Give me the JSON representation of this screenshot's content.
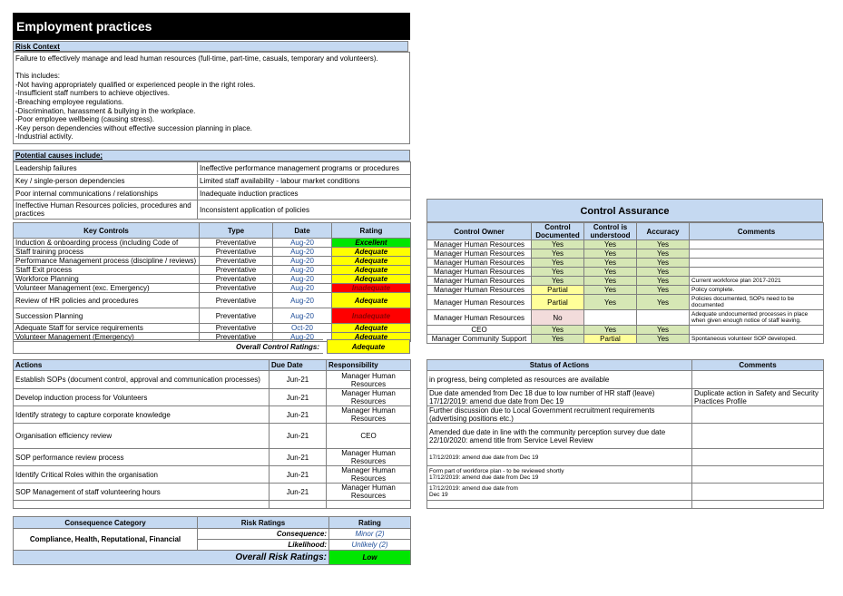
{
  "title": "Employment practices",
  "risk_context": {
    "heading": "Risk Context",
    "lines": [
      "Failure to effectively manage and lead human resources (full-time, part-time, casuals, temporary and volunteers).",
      "",
      "This includes:",
      "-Not having appropriately qualified or experienced people in the right roles.",
      "-Insufficient staff numbers to achieve objectives.",
      "-Breaching employee regulations.",
      "-Discrimination, harassment & bullying in the workplace.",
      "-Poor employee wellbeing (causing stress).",
      "-Key person dependencies without effective succession planning in place.",
      "-Industrial activity."
    ]
  },
  "causes": {
    "heading": "Potential causes include;",
    "rows": [
      [
        "Leadership failures",
        "Ineffective performance management programs or procedures"
      ],
      [
        "Key / single-person dependencies",
        "Limited staff availability - labour market conditions"
      ],
      [
        "Poor internal communications / relationships",
        "Inadequate induction practices"
      ],
      [
        "Ineffective Human Resources policies, procedures and practices",
        "Inconsistent application of policies"
      ]
    ]
  },
  "controls": {
    "headers": [
      "Key Controls",
      "Type",
      "Date",
      "Rating"
    ],
    "rows": [
      {
        "control": "Induction & onboarding process (including Code of",
        "type": "Preventative",
        "date": "Aug-20",
        "rating": "Excellent",
        "rc": "grn"
      },
      {
        "control": "Staff training process",
        "type": "Preventative",
        "date": "Aug-20",
        "rating": "Adequate",
        "rc": "yel"
      },
      {
        "control": "Performance Management process (discipline / reviews)",
        "type": "Preventative",
        "date": "Aug-20",
        "rating": "Adequate",
        "rc": "yel"
      },
      {
        "control": "Staff Exit process",
        "type": "Preventative",
        "date": "Aug-20",
        "rating": "Adequate",
        "rc": "yel"
      },
      {
        "control": "Workforce Planning",
        "type": "Preventative",
        "date": "Aug-20",
        "rating": "Adequate",
        "rc": "yel"
      },
      {
        "control": "Volunteer Management (exc. Emergency)",
        "type": "Preventative",
        "date": "Aug-20",
        "rating": "Inadequate",
        "rc": "red"
      },
      {
        "control": "Review of HR policies and procedures",
        "type": "Preventative",
        "date": "Aug-20",
        "rating": "Adequate",
        "rc": "yel"
      },
      {
        "control": "Succession Planning",
        "type": "Preventative",
        "date": "Aug-20",
        "rating": "Inadequate",
        "rc": "red"
      },
      {
        "control": "Adequate Staff for service requirements",
        "type": "Preventative",
        "date": "Oct-20",
        "rating": "Adequate",
        "rc": "yel"
      },
      {
        "control": "Volunteer Management (Emergency)",
        "type": "Preventative",
        "date": "Aug-20",
        "rating": "Adequate",
        "rc": "yel"
      }
    ],
    "overall_label": "Overall Control Ratings:",
    "overall_value": "Adequate"
  },
  "assurance": {
    "title": "Control Assurance",
    "headers": [
      "Control Owner",
      "Control Documented",
      "Control is understood",
      "Accuracy",
      "Comments"
    ],
    "rows": [
      {
        "owner": "Manager Human Resources",
        "doc": "Yes",
        "dc": "lg",
        "und": "Yes",
        "uc": "lg",
        "acc": "Yes",
        "ac": "lg",
        "comment": ""
      },
      {
        "owner": "Manager Human Resources",
        "doc": "Yes",
        "dc": "lg",
        "und": "Yes",
        "uc": "lg",
        "acc": "Yes",
        "ac": "lg",
        "comment": ""
      },
      {
        "owner": "Manager Human Resources",
        "doc": "Yes",
        "dc": "lg",
        "und": "Yes",
        "uc": "lg",
        "acc": "Yes",
        "ac": "lg",
        "comment": ""
      },
      {
        "owner": "Manager Human Resources",
        "doc": "Yes",
        "dc": "lg",
        "und": "Yes",
        "uc": "lg",
        "acc": "Yes",
        "ac": "lg",
        "comment": ""
      },
      {
        "owner": "Manager Human Resources",
        "doc": "Yes",
        "dc": "lg",
        "und": "Yes",
        "uc": "lg",
        "acc": "Yes",
        "ac": "lg",
        "comment": "Current workforce plan 2017-2021"
      },
      {
        "owner": "Manager Human Resources",
        "doc": "Partial",
        "dc": "ly",
        "und": "Yes",
        "uc": "lg",
        "acc": "Yes",
        "ac": "lg",
        "comment": "Policy complete."
      },
      {
        "owner": "Manager Human Resources",
        "doc": "Partial",
        "dc": "ly",
        "und": "Yes",
        "uc": "lg",
        "acc": "Yes",
        "ac": "lg",
        "comment": "Policies documented, SOPs need to be documented"
      },
      {
        "owner": "Manager Human Resources",
        "doc": "No",
        "dc": "pk",
        "und": "",
        "uc": "",
        "acc": "",
        "ac": "",
        "comment": "Adequate undocumented processes in place when given enough notice of staff leaving."
      },
      {
        "owner": "CEO",
        "doc": "Yes",
        "dc": "lg",
        "und": "Yes",
        "uc": "lg",
        "acc": "Yes",
        "ac": "lg",
        "comment": ""
      },
      {
        "owner": "Manager Community Support",
        "doc": "Yes",
        "dc": "lg",
        "und": "Partial",
        "uc": "ly",
        "acc": "Yes",
        "ac": "lg",
        "comment": "Spontaneous volunteer SOP developed."
      }
    ]
  },
  "actions": {
    "headers": [
      "Actions",
      "Due Date",
      "Responsibility"
    ],
    "rows": [
      {
        "action": "Establish SOPs (document control, approval and communication processes)",
        "due": "Jun-21",
        "resp": "Manager Human Resources"
      },
      {
        "action": "Develop induction process for Volunteers",
        "due": "Jun-21",
        "resp": "Manager Human Resources"
      },
      {
        "action": "Identify strategy to capture corporate knowledge",
        "due": "Jun-21",
        "resp": "Manager Human Resources"
      },
      {
        "action": "Organisation efficiency review",
        "due": "Jun-21",
        "resp": "CEO"
      },
      {
        "action": "SOP performance review process",
        "due": "Jun-21",
        "resp": "Manager Human Resources"
      },
      {
        "action": "Identify Critical Roles within the organisation",
        "due": "Jun-21",
        "resp": "Manager Human Resources"
      },
      {
        "action": "SOP Management of staff volunteering hours",
        "due": "Jun-21",
        "resp": "Manager Human Resources"
      }
    ]
  },
  "status": {
    "headers": [
      "Status of Actions",
      "Comments"
    ],
    "rows": [
      {
        "status": "in progress, being completed as resources are available",
        "comment": ""
      },
      {
        "status": "Due date amended from Dec 18 due to low number of HR staff (leave)\n17/12/2019: amend due date from Dec 19",
        "comment": "Duplicate action in Safety and Security Practices Profile"
      },
      {
        "status": "Further discussion due to Local Government recruitment requirements (advertising positions etc.)",
        "comment": ""
      },
      {
        "status": "Amended due date in line with the community perception survey due date\n22/10/2020: amend title from Service Level Review",
        "comment": ""
      },
      {
        "status": "17/12/2019: amend due date from Dec 19",
        "comment": ""
      },
      {
        "status": "Form part of workforce plan - to be reviewed shortly\n17/12/2019: amend due date from Dec 19",
        "comment": ""
      },
      {
        "status": "17/12/2019: amend due date from\nDec 19",
        "comment": ""
      }
    ]
  },
  "consequence": {
    "headers": [
      "Consequence Category",
      "Risk Ratings",
      "Rating"
    ],
    "category": "Compliance, Health, Reputational, Financial",
    "consequence_label": "Consequence:",
    "consequence_value": "Minor (2)",
    "likelihood_label": "Likelihood:",
    "likelihood_value": "Unlikely (2)",
    "overall_label": "Overall Risk Ratings:",
    "overall_value": "Low"
  }
}
